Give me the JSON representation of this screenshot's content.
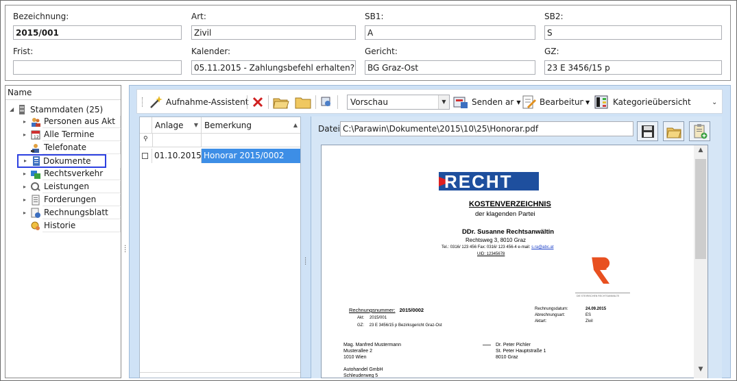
{
  "header": {
    "bezeichnung": {
      "label": "Bezeichnung:",
      "value": "2015/001"
    },
    "art": {
      "label": "Art:",
      "value": "Zivil"
    },
    "sb1": {
      "label": "SB1:",
      "value": "A"
    },
    "sb2": {
      "label": "SB2:",
      "value": "S"
    },
    "frist": {
      "label": "Frist:",
      "value": ""
    },
    "kalender": {
      "label": "Kalender:",
      "value": "05.11.2015 - Zahlungsbefehl erhalten?"
    },
    "gericht": {
      "label": "Gericht:",
      "value": "BG Graz-Ost"
    },
    "gz": {
      "label": "GZ:",
      "value": "23 E 3456/15 p"
    }
  },
  "tree": {
    "header": "Name",
    "root": "Stammdaten (25)",
    "items": [
      {
        "label": "Personen aus Akt",
        "icon": "persons-icon"
      },
      {
        "label": "Alle Termine",
        "icon": "calendar-icon"
      },
      {
        "label": "Telefonate",
        "icon": "phone-call-icon"
      },
      {
        "label": "Dokumente",
        "icon": "documents-icon"
      },
      {
        "label": "Rechtsverkehr",
        "icon": "legal-traffic-icon"
      },
      {
        "label": "Leistungen",
        "icon": "services-icon"
      },
      {
        "label": "Forderungen",
        "icon": "claims-icon"
      },
      {
        "label": "Rechnungsblatt",
        "icon": "invoice-sheet-icon"
      },
      {
        "label": "Historie",
        "icon": "history-icon"
      }
    ]
  },
  "toolbar": {
    "wizard": "Aufnahme-Assistent",
    "view_select": "Vorschau",
    "send": "Senden ar",
    "edit": "Bearbeitung",
    "category": "Kategorieübersicht"
  },
  "grid": {
    "columns": [
      "Anlage",
      "Bemerkung"
    ],
    "rows": [
      {
        "anlage": "01.10.2015",
        "bemerkung": "Honorar 2015/0002"
      }
    ]
  },
  "preview": {
    "datei_label": "Datei",
    "datei_path": "C:\\Parawin\\Dokumente\\2015\\10\\25\\Honorar.pdf"
  },
  "document": {
    "logo": "RECHT",
    "title": "KOSTENVERZEICHNIS",
    "subtitle": "der klagenden Partei",
    "lawyer": "DDr. Susanne Rechtsanwältin",
    "address": "Rechtsweg 3, 8010 Graz",
    "contact_prefix": "Tel.: 0316/ 123 456 Fax: 0316/ 123 456-4 e-mail:",
    "email": "s.ra@abc.at",
    "uid": "UID: 12345678",
    "seal_caption": "DIE STEIRISCHEN RECHTSANWÄLTE",
    "invoice_label": "Rechnungsnummer:",
    "invoice_no": "2015/0002",
    "akt_label": "Akt:",
    "akt": "2015/001",
    "gz_label": "GZ:",
    "gz": "23 E 3456/15 p Bezirksgericht Graz-Ost",
    "date_label": "Rechnungsdatum:",
    "date": "24.09.2015",
    "abr_label": "Abrechnungsart:",
    "abr": "ES",
    "aktart_label": "Aktart:",
    "aktart": "Zivil",
    "client_name": "Mag.  Manfred Mustermann",
    "client_street": "Musterallee 2",
    "client_city": "1010 Wien",
    "opp_name": "Dr. Peter Pichler",
    "opp_street": "St. Peter Hauptstraße 1",
    "opp_city": "8010 Graz",
    "third_name": "Autohandel GmbH",
    "third_street": "Schleuderweg 5"
  }
}
